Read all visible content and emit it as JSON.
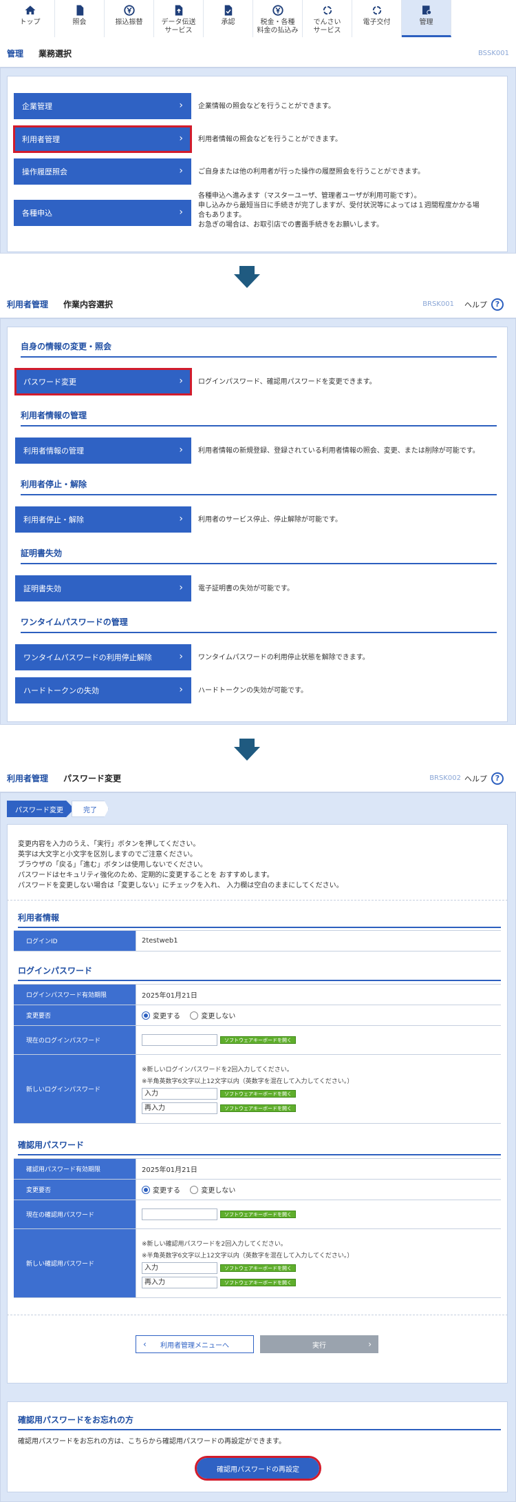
{
  "nav": {
    "items": [
      {
        "label": "トップ",
        "icon": "home-icon"
      },
      {
        "label": "照会",
        "icon": "document-icon"
      },
      {
        "label": "振込振替",
        "icon": "yen-circle-icon"
      },
      {
        "label": "データ伝送\nサービス",
        "icon": "data-upload-icon"
      },
      {
        "label": "承認",
        "icon": "approve-document-icon"
      },
      {
        "label": "税金・各種\n料金の払込み",
        "icon": "tax-payment-icon"
      },
      {
        "label": "でんさい\nサービス",
        "icon": "densai-icon"
      },
      {
        "label": "電子交付",
        "icon": "electronic-delivery-icon"
      },
      {
        "label": "管理",
        "icon": "management-icon"
      }
    ],
    "active": 8
  },
  "screen1": {
    "category": "管理",
    "title": "業務選択",
    "code": "BSSK001",
    "items": [
      {
        "label": "企業管理",
        "desc": "企業情報の照会などを行うことができます。"
      },
      {
        "label": "利用者管理",
        "desc": "利用者情報の照会などを行うことができます。"
      },
      {
        "label": "操作履歴照会",
        "desc": "ご自身または他の利用者が行った操作の履歴照会を行うことができます。"
      },
      {
        "label": "各種申込",
        "desc1": "各種申込へ進みます（マスターユーザ、管理者ユーザが利用可能です）。",
        "desc2": "申し込みから最短当日に手続きが完了しますが、受付状況等によっては１週間程度かかる場",
        "desc3": "合もあります。",
        "desc4": "お急ぎの場合は、お取引店での書面手続きをお願いします。"
      }
    ]
  },
  "screen2": {
    "category": "利用者管理",
    "title": "作業内容選択",
    "code": "BRSK001",
    "help": "ヘルプ",
    "sections": [
      {
        "title": "自身の情報の変更・照会",
        "items": [
          {
            "label": "パスワード変更",
            "desc": "ログインパスワード、確認用パスワードを変更できます。"
          }
        ]
      },
      {
        "title": "利用者情報の管理",
        "items": [
          {
            "label": "利用者情報の管理",
            "desc": "利用者情報の新規登録、登録されている利用者情報の照会、変更、または削除が可能です。"
          }
        ]
      },
      {
        "title": "利用者停止・解除",
        "items": [
          {
            "label": "利用者停止・解除",
            "desc": "利用者のサービス停止、停止解除が可能です。"
          }
        ]
      },
      {
        "title": "証明書失効",
        "items": [
          {
            "label": "証明書失効",
            "desc": "電子証明書の失効が可能です。"
          }
        ]
      },
      {
        "title": "ワンタイムパスワードの管理",
        "items": [
          {
            "label": "ワンタイムパスワードの利用停止解除",
            "desc": "ワンタイムパスワードの利用停止状態を解除できます。"
          },
          {
            "label": "ハードトークンの失効",
            "desc": "ハードトークンの失効が可能です。"
          }
        ]
      }
    ]
  },
  "screen3": {
    "category": "利用者管理",
    "title": "パスワード変更",
    "code": "BRSK002",
    "help": "ヘルプ",
    "steps": [
      "パスワード変更",
      "完了"
    ],
    "intro": [
      "変更内容を入力のうえ、「実行」ボタンを押してください。",
      "英字は大文字と小文字を区別しますのでご注意ください。",
      "ブラウザの「戻る」「進む」ボタンは使用しないでください。",
      "パスワードはセキュリティ強化のため、定期的に変更することを おすすめします。",
      "パスワードを変更しない場合は「変更しない」にチェックを入れ、 入力欄は空白のままにしてください。"
    ],
    "user_info": {
      "title": "利用者情報",
      "login_id_label": "ログインID",
      "login_id": "2testweb1"
    },
    "login_pw": {
      "title": "ログインパスワード",
      "expiry_label": "ログインパスワード有効期限",
      "expiry": "2025年01月21日",
      "change_label": "変更要否",
      "opt_change": "変更する",
      "opt_nochange": "変更しない",
      "current_label": "現在のログインパスワード",
      "new_label": "新しいログインパスワード",
      "note1": "※新しいログインパスワードを2回入力してください。",
      "note2": "※半角英数字6文字以上12文字以内（英数字を混在して入力してください。）",
      "ph_input": "入力",
      "ph_reinput": "再入力"
    },
    "confirm_pw": {
      "title": "確認用パスワード",
      "expiry_label": "確認用パスワード有効期限",
      "expiry": "2025年01月21日",
      "change_label": "変更要否",
      "opt_change": "変更する",
      "opt_nochange": "変更しない",
      "current_label": "現在の確認用パスワード",
      "new_label": "新しい確認用パスワード",
      "note1": "※新しい確認用パスワードを2回入力してください。",
      "note2": "※半角英数字6文字以上12文字以内（英数字を混在して入力してください。）",
      "ph_input": "入力",
      "ph_reinput": "再入力"
    },
    "keyboard_label": "ソフトウェアキーボードを開く",
    "back_label": "利用者管理メニューへ",
    "exec_label": "実行",
    "forgot": {
      "title": "確認用パスワードをお忘れの方",
      "text": "確認用パスワードをお忘れの方は、こちらから確認用パスワードの再設定ができます。",
      "button": "確認用パスワードの再設定"
    }
  }
}
